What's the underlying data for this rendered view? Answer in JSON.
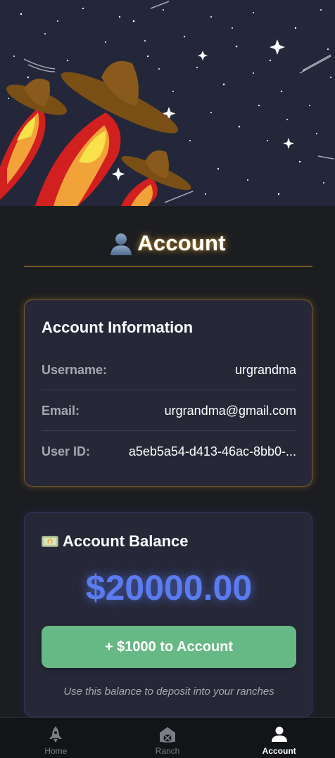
{
  "page": {
    "title": "Account",
    "title_icon": "user-silhouette-icon"
  },
  "account_info": {
    "heading": "Account Information",
    "rows": [
      {
        "label": "Username:",
        "value": "urgrandma"
      },
      {
        "label": "Email:",
        "value": "urgrandma@gmail.com"
      },
      {
        "label": "User ID:",
        "value": "a5eb5a54-d413-46ac-8bb0-..."
      }
    ]
  },
  "balance": {
    "heading": "Account Balance",
    "heading_icon": "money-icon",
    "amount": "$20000.00",
    "add_button_label": "+ $1000 to Account",
    "hint": "Use this balance to deposit into your ranches"
  },
  "nav": {
    "items": [
      {
        "label": "Home",
        "icon": "rocket-icon",
        "active": false
      },
      {
        "label": "Ranch",
        "icon": "barn-icon",
        "active": false
      },
      {
        "label": "Account",
        "icon": "person-icon",
        "active": true
      }
    ]
  },
  "colors": {
    "background": "#1c1d20",
    "card": "#262838",
    "accent_gold": "#d99a2b",
    "balance_blue": "#5b7cf0",
    "button_green": "#66b884"
  }
}
